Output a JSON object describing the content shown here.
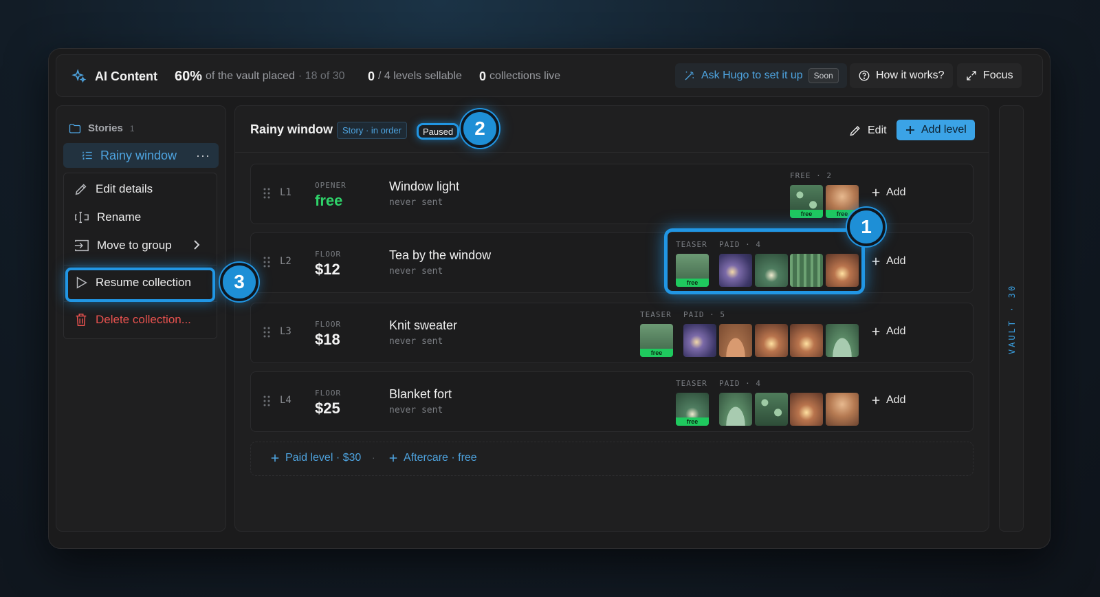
{
  "topbar": {
    "brand": "AI Content",
    "vault_pct": "60%",
    "vault_text": "of the vault placed",
    "vault_count": "· 18 of 30",
    "levels_num": "0",
    "levels_text": "/ 4 levels sellable",
    "collections_num": "0",
    "collections_text": "collections live",
    "ask_label": "Ask Hugo to set it up",
    "soon_label": "Soon",
    "how_label": "How it works?",
    "focus_label": "Focus"
  },
  "sidebar": {
    "group_label": "Stories",
    "group_count": "1",
    "active_item": "Rainy window",
    "more_label": "···",
    "menu": {
      "edit": "Edit details",
      "rename": "Rename",
      "move": "Move to group",
      "resume": "Resume collection",
      "delete": "Delete collection..."
    }
  },
  "collection": {
    "title": "Rainy window",
    "type_tag": "Story · in order",
    "status_tag": "Paused",
    "edit_label": "Edit",
    "add_level_label": "Add level"
  },
  "levels": [
    {
      "level": "L1",
      "tier": "OPENER",
      "price": "free",
      "title": "Window light",
      "status": "never sent",
      "group_label": "FREE · 2",
      "add": "Add"
    },
    {
      "level": "L2",
      "tier": "FLOOR",
      "price": "$12",
      "title": "Tea by the window",
      "status": "never sent",
      "teaser_label": "TEASER",
      "group_label": "PAID · 4",
      "add": "Add"
    },
    {
      "level": "L3",
      "tier": "FLOOR",
      "price": "$18",
      "title": "Knit sweater",
      "status": "never sent",
      "teaser_label": "TEASER",
      "group_label": "PAID · 5",
      "add": "Add"
    },
    {
      "level": "L4",
      "tier": "FLOOR",
      "price": "$25",
      "title": "Blanket fort",
      "status": "never sent",
      "teaser_label": "TEASER",
      "group_label": "PAID · 4",
      "add": "Add"
    }
  ],
  "free_badge": "free",
  "add_paid_level": "Paid level · $30",
  "add_aftercare": "Aftercare · free",
  "separator": "·",
  "vault_rail": "VAULT · 30",
  "callouts": [
    "1",
    "2",
    "3"
  ],
  "accent_color": "#2196e4"
}
